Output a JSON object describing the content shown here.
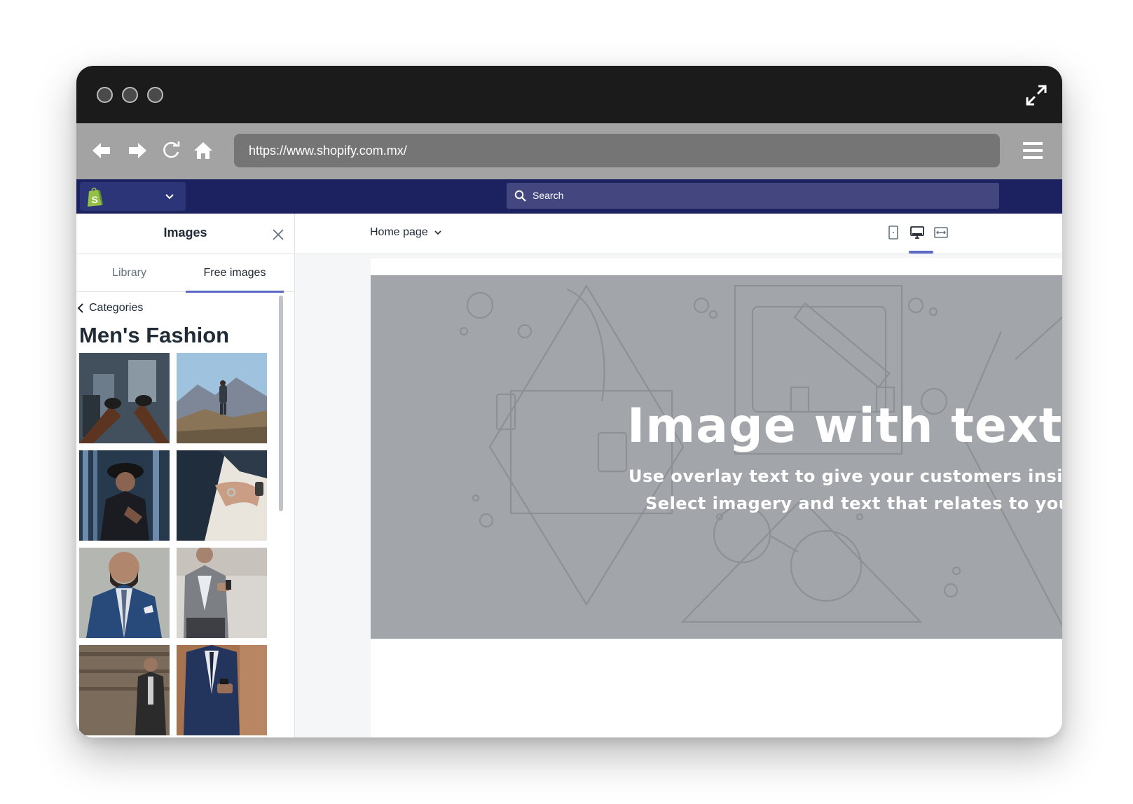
{
  "browser": {
    "url": "https://www.shopify.com.mx/"
  },
  "appbar": {
    "search_placeholder": "Search"
  },
  "sidebar": {
    "title": "Images",
    "tabs": [
      {
        "label": "Library"
      },
      {
        "label": "Free images"
      }
    ],
    "active_tab": "Free images",
    "back_label": "Categories",
    "category_title": "Men's Fashion"
  },
  "editor": {
    "page_select": "Home page"
  },
  "hero": {
    "title": "Image with text o",
    "subtitle_line1": "Use overlay text to give your customers insig",
    "subtitle_line2": "Select imagery and text that relates to you"
  },
  "colors": {
    "appbar": "#1c2260",
    "accent": "#5c6ac4",
    "hero_bg": "#a2a5a9"
  }
}
